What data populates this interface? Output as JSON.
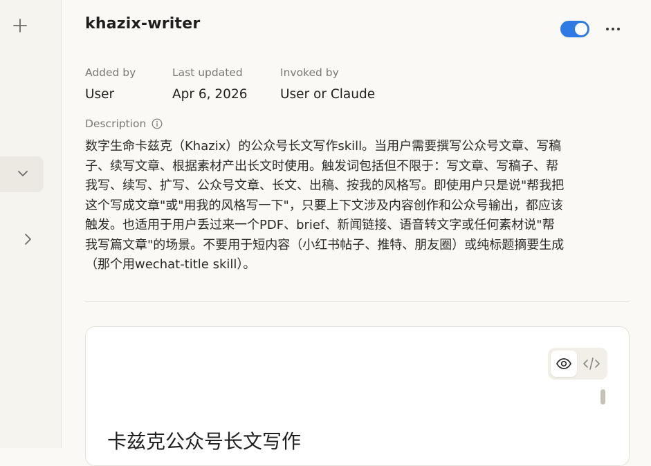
{
  "skill": {
    "name": "khazix-writer",
    "enabled": true
  },
  "meta": {
    "added_by_label": "Added by",
    "added_by_value": "User",
    "updated_label": "Last updated",
    "updated_value": "Apr 6, 2026",
    "invoked_label": "Invoked by",
    "invoked_value": "User or Claude"
  },
  "description": {
    "label": "Description",
    "text": "数字生命卡兹克（Khazix）的公众号长文写作skill。当用户需要撰写公众号文章、写稿\n子、续写文章、根据素材产出长文时使用。触发词包括但不限于：写文章、写稿子、帮\n我写、续写、扩写、公众号文章、长文、出稿、按我的风格写。即使用户只是说\"帮我把\n这个写成文章\"或\"用我的风格写一下\"，只要上下文涉及内容创作和公众号输出，都应该\n触发。也适用于用户丢过来一个PDF、brief、新闻链接、语音转文字或任何素材说\"帮\n我写篇文章\"的场景。不要用于短内容（小红书帖子、推特、朋友圈）或纯标题摘要生成\n（那个用wechat-title skill）。"
  },
  "preview": {
    "heading": "卡兹克公众号长文写作"
  },
  "icons": {
    "sidebar_add": "plus-icon",
    "sidebar_expand": "chevron-down-icon",
    "sidebar_next": "chevron-right-icon",
    "more": "more-horizontal-icon",
    "info": "info-icon",
    "preview_mode": "eye-icon",
    "code_mode": "code-icon"
  },
  "colors": {
    "toggle_on": "#2f7be5",
    "background": "#faf9f5"
  }
}
